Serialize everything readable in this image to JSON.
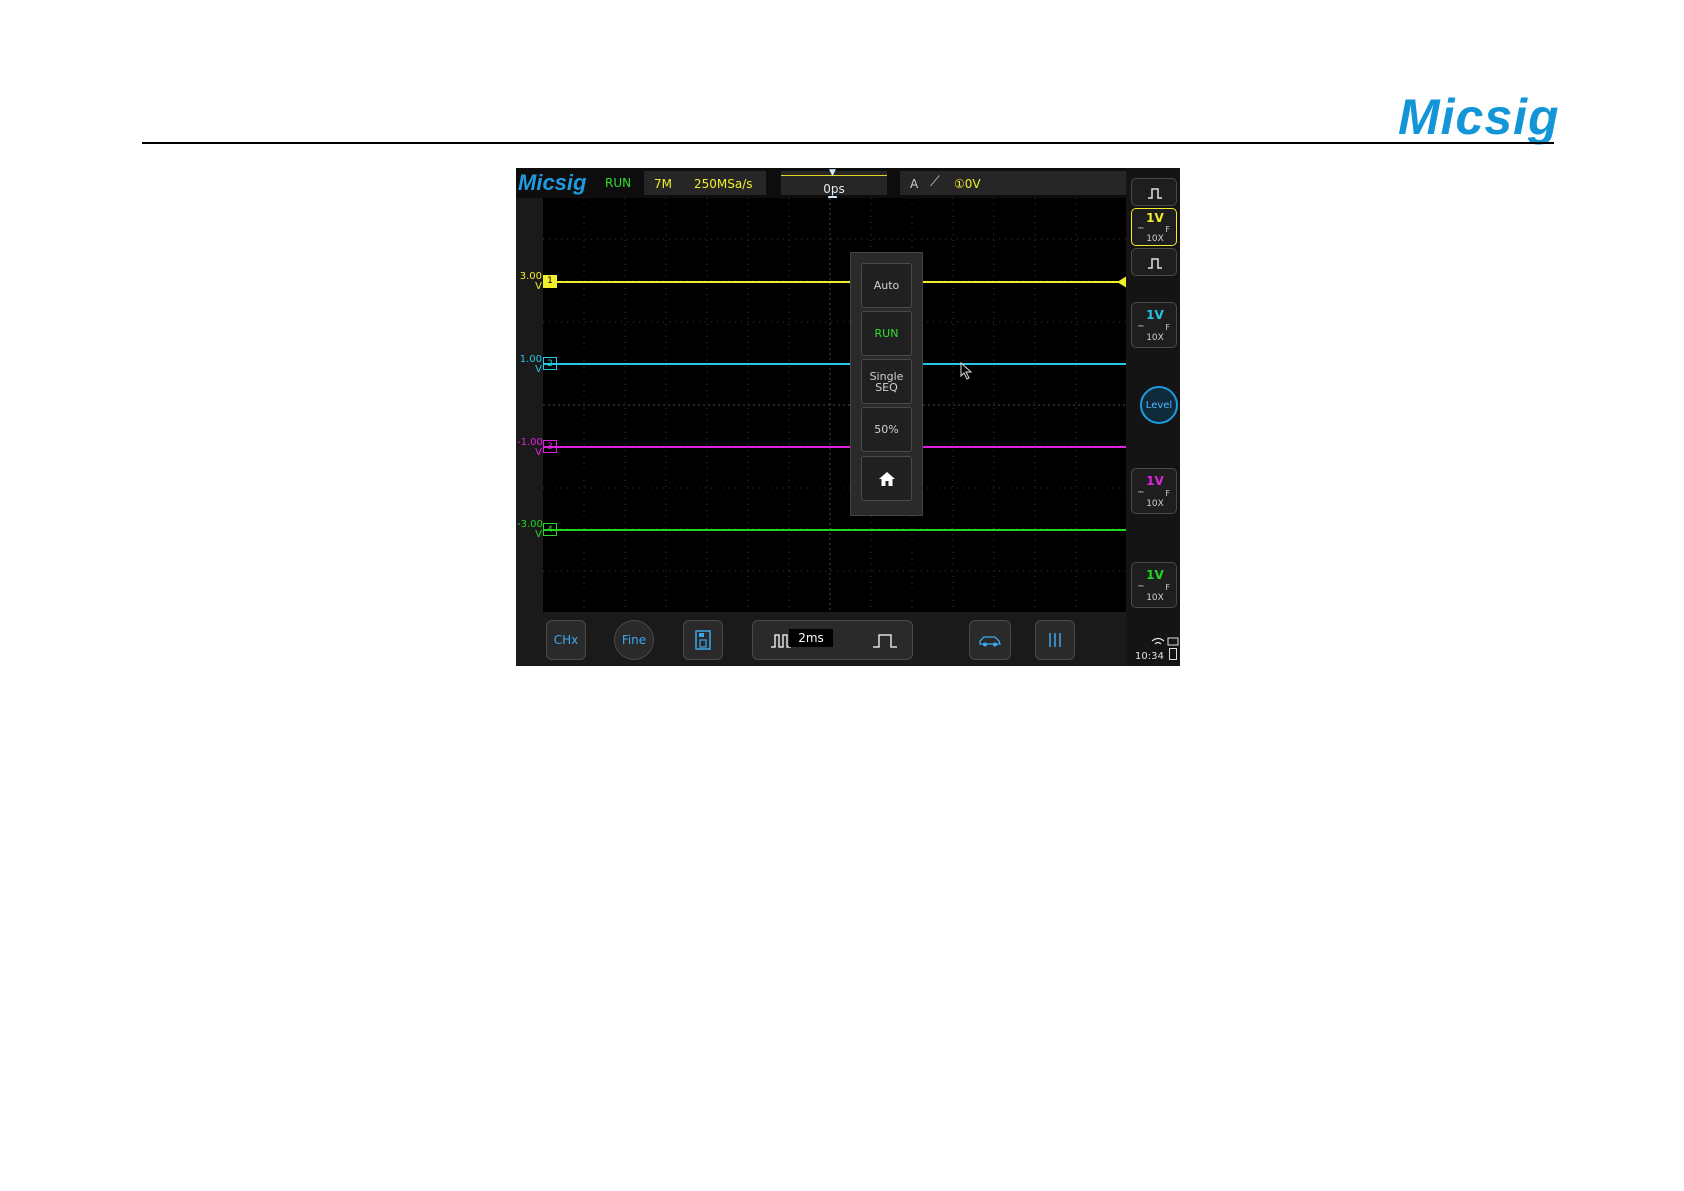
{
  "page": {
    "logo": "Micsig"
  },
  "scope": {
    "brand": "Micsig",
    "status": "RUN",
    "memory": "7M",
    "sample_rate": "250MSa/s",
    "time_offset": "0ps",
    "trigger": {
      "source": "A",
      "edge_icon": "rising-edge-icon",
      "level_prefix": "①",
      "level": "0V"
    },
    "channels": [
      {
        "id": "1",
        "offset": "3.00",
        "unit": "V",
        "color": "#f2ee2c",
        "vdiv": "1V",
        "coupling": "⎓",
        "filter": "F",
        "probe": "10X"
      },
      {
        "id": "2",
        "offset": "1.00",
        "unit": "V",
        "color": "#26c6e6",
        "vdiv": "1V",
        "coupling": "⎓",
        "filter": "F",
        "probe": "10X"
      },
      {
        "id": "3",
        "offset": "-1.00",
        "unit": "V",
        "color": "#e022e0",
        "vdiv": "1V",
        "coupling": "⎓",
        "filter": "F",
        "probe": "10X"
      },
      {
        "id": "4",
        "offset": "-3.00",
        "unit": "V",
        "color": "#22d622",
        "vdiv": "1V",
        "coupling": "⎓",
        "filter": "F",
        "probe": "10X"
      }
    ],
    "popup": [
      "Auto",
      "RUN",
      "Single SEQ",
      "50%"
    ],
    "popup_home_icon": "home-icon",
    "level_label": "Level",
    "bottom": {
      "chx": "CHx",
      "fine": "Fine",
      "timebase": "2ms"
    },
    "clock": "10:34"
  }
}
